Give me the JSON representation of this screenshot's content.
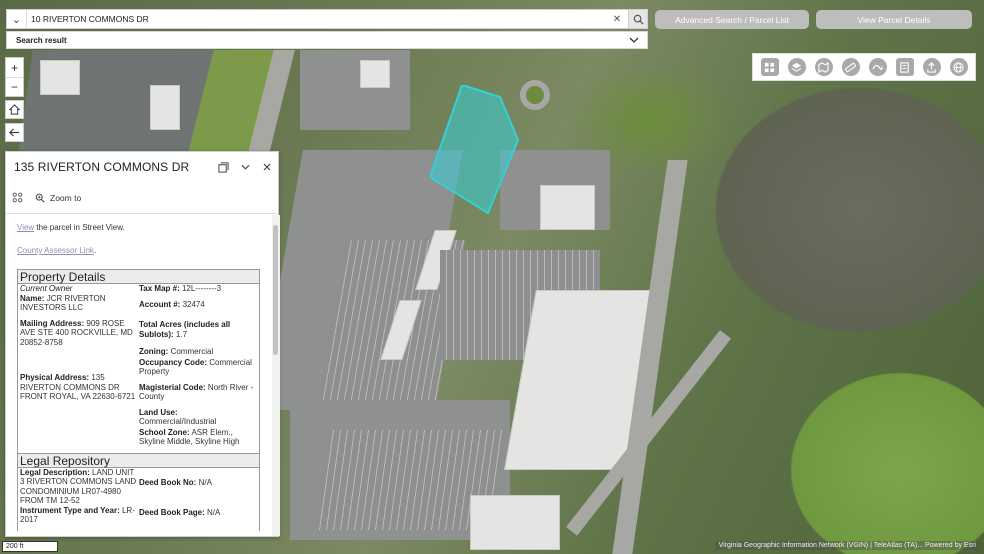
{
  "search": {
    "value": "10 RIVERTON COMMONS DR",
    "result_label": "Search result"
  },
  "top_buttons": {
    "advanced": "Advanced Search / Parcel List",
    "details": "View Parcel Details"
  },
  "map_controls": {
    "zoom_in": "+",
    "zoom_out": "−"
  },
  "toolbar": {
    "tools": [
      "basemap-gallery-icon",
      "layers-icon",
      "map-tools-icon",
      "measure-icon",
      "sketch-icon",
      "print-icon",
      "share-icon",
      "globe-icon"
    ]
  },
  "popup": {
    "title": "135 RIVERTON COMMONS DR",
    "zoom_to": "Zoom to",
    "street_view_link": "View",
    "street_view_text": " the parcel in Street View.",
    "assessor_link": "County Assessor Link",
    "assessor_tail": ".",
    "property": {
      "heading": "Property Details",
      "current_owner_label": "Current Owner",
      "name_label": "Name:",
      "name_value": "JCR RIVERTON INVESTORS LLC",
      "mailing_label": "Mailing Address:",
      "mailing_value": "909 ROSE AVE STE 400 ROCKVILLE, MD 20852-8758",
      "physical_label": "Physical Address:",
      "physical_value": "135 RIVERTON COMMONS DR FRONT ROYAL, VA 22630-6721",
      "tax_map_label": "Tax Map #:",
      "tax_map_value": "12L--------3",
      "account_label": "Account #:",
      "account_value": "32474",
      "acres_label": "Total Acres (includes all Sublots):",
      "acres_value": "1.7",
      "zoning_label": "Zoning:",
      "zoning_value": "Commercial",
      "occupancy_label": "Occupancy Code:",
      "occupancy_value": "Commercial Property",
      "magisterial_label": "Magisterial Code:",
      "magisterial_value": "North River - County",
      "land_use_label": "Land Use:",
      "land_use_value": "Commercial/Industrial",
      "school_label": "School Zone:",
      "school_value": "ASR Elem., Skyline Middle, Skyline High"
    },
    "legal": {
      "heading": "Legal Repository",
      "description_label": "Legal Description:",
      "description_value": "LAND UNIT 3 RIVERTON COMMONS LAND CONDOMINIUM LR07-4980 FROM TM 12-52",
      "instrument_label": "Instrument Type and Year:",
      "instrument_value": "LR-2017",
      "deed_book_no_label": "Deed Book No:",
      "deed_book_no_value": "N/A",
      "deed_book_page_label": "Deed Book Page:",
      "deed_book_page_value": "N/A"
    }
  },
  "scale_bar": "200 ft",
  "attribution": "Virginia Geographic Information Network (VGIN) | TeleAtlas (TA)... Powered by Esri",
  "colors": {
    "highlight": "#34d0d6",
    "button_gray": "#bdbdbd",
    "link": "#8a8fb6"
  }
}
